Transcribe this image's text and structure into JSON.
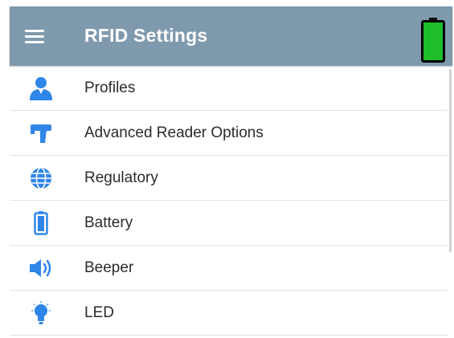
{
  "header": {
    "title": "RFID Settings",
    "menu_icon": "hamburger-menu-icon",
    "battery_icon": "battery-full-icon",
    "battery_level": 1.0,
    "battery_color": "#1fbf2a"
  },
  "colors": {
    "app_bar": "#7f99ad",
    "icon_accent": "#2f86e8",
    "text": "#2b2b2b",
    "divider": "#e2e2e2"
  },
  "menu": {
    "items": [
      {
        "label": "Profiles",
        "icon": "person-icon"
      },
      {
        "label": "Advanced Reader Options",
        "icon": "reader-gun-icon"
      },
      {
        "label": "Regulatory",
        "icon": "globe-icon"
      },
      {
        "label": "Battery",
        "icon": "battery-icon"
      },
      {
        "label": "Beeper",
        "icon": "speaker-icon"
      },
      {
        "label": "LED",
        "icon": "light-bulb-icon"
      }
    ]
  }
}
